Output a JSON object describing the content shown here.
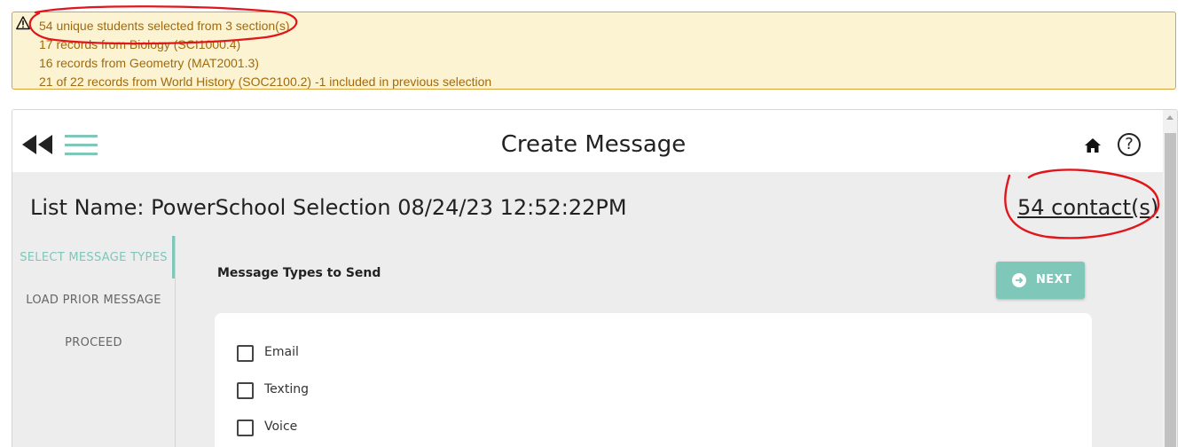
{
  "alert": {
    "icon": "warning-icon",
    "lines": [
      "54 unique students selected from 3 section(s).",
      "17 records from Biology (SCI1000.4)",
      "16 records from Geometry (MAT2001.3)",
      "21 of 22 records from World History (SOC2100.2) -1 included in previous selection"
    ],
    "color": "#a26a0a",
    "background": "#fcf3d2"
  },
  "header": {
    "title": "Create Message",
    "back_icon": "double-chevron-left-icon",
    "menu_icon": "hamburger-menu-icon",
    "home_icon": "home-icon",
    "help_glyph": "?"
  },
  "list": {
    "name": "List Name: PowerSchool Selection 08/24/23 12:52:22PM",
    "contacts": "54 contact(s)"
  },
  "steps": [
    {
      "label": "SELECT MESSAGE TYPES",
      "active": true
    },
    {
      "label": "LOAD PRIOR MESSAGE",
      "active": false
    },
    {
      "label": "PROCEED",
      "active": false
    }
  ],
  "message_types": {
    "heading": "Message Types to Send",
    "next_label": "NEXT",
    "options": [
      {
        "label": "Email",
        "checked": false
      },
      {
        "label": "Texting",
        "checked": false
      },
      {
        "label": "Voice",
        "checked": false
      }
    ]
  },
  "colors": {
    "accent": "#7ec7b9",
    "annotation": "#e0161b"
  }
}
